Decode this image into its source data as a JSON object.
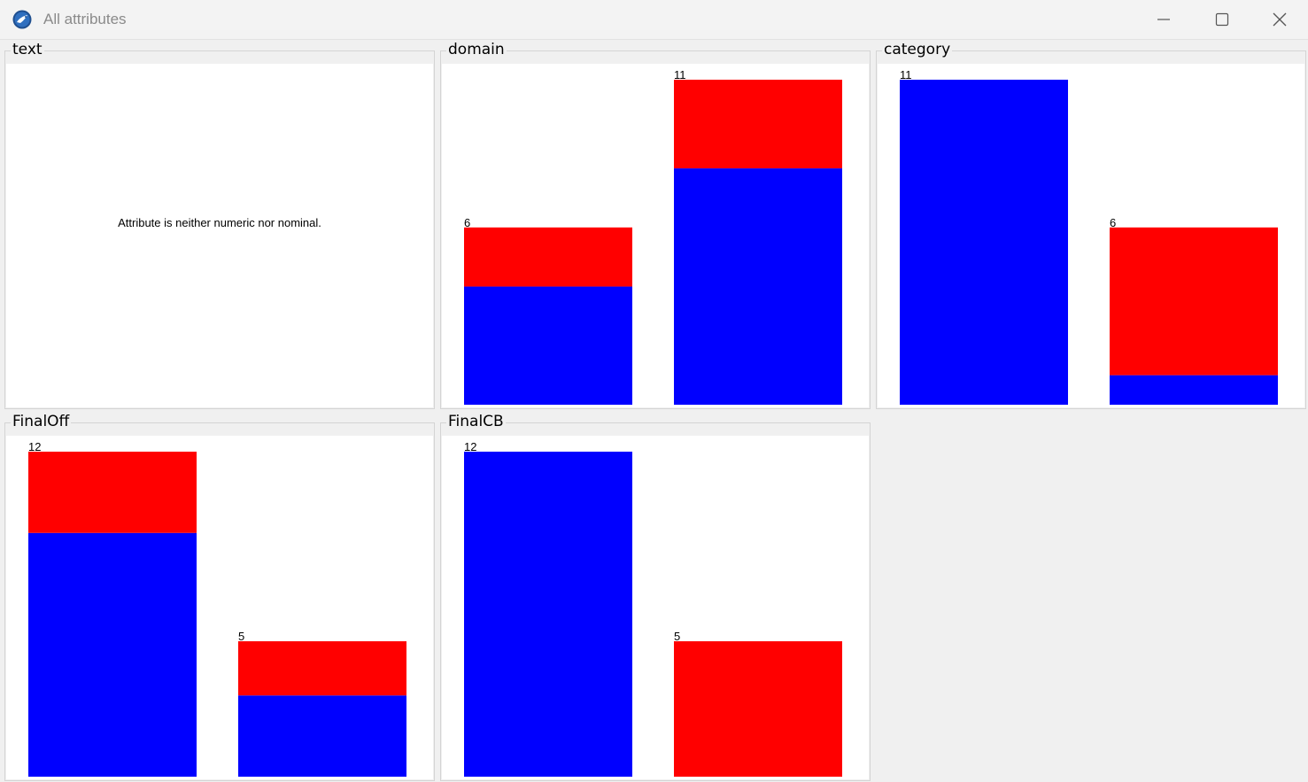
{
  "window": {
    "title": "All attributes",
    "app_icon": "weka-bird-icon",
    "controls": {
      "minimize_icon": "minimize-icon",
      "maximize_icon": "maximize-icon",
      "close_icon": "close-icon"
    }
  },
  "colors": {
    "class_a": "#0000ff",
    "class_b": "#ff0000"
  },
  "panels": [
    {
      "label": "text",
      "message": "Attribute is neither numeric nor nominal."
    },
    {
      "label": "domain"
    },
    {
      "label": "category"
    },
    {
      "label": "FinalOff"
    },
    {
      "label": "FinalCB"
    }
  ],
  "chart_data": [
    {
      "type": "bar",
      "stacked": true,
      "title": "domain",
      "bars": [
        {
          "total": 6,
          "segments": [
            4,
            2
          ],
          "label": "6"
        },
        {
          "total": 11,
          "segments": [
            8,
            3
          ],
          "label": "11"
        }
      ],
      "series_colors": [
        "#0000ff",
        "#ff0000"
      ]
    },
    {
      "type": "bar",
      "stacked": true,
      "title": "category",
      "bars": [
        {
          "total": 11,
          "segments": [
            11,
            0
          ],
          "label": "11"
        },
        {
          "total": 6,
          "segments": [
            1,
            5
          ],
          "label": "6"
        }
      ],
      "series_colors": [
        "#0000ff",
        "#ff0000"
      ]
    },
    {
      "type": "bar",
      "stacked": true,
      "title": "FinalOff",
      "bars": [
        {
          "total": 12,
          "segments": [
            9,
            3
          ],
          "label": "12"
        },
        {
          "total": 5,
          "segments": [
            3,
            2
          ],
          "label": "5"
        }
      ],
      "series_colors": [
        "#0000ff",
        "#ff0000"
      ]
    },
    {
      "type": "bar",
      "stacked": true,
      "title": "FinalCB",
      "bars": [
        {
          "total": 12,
          "segments": [
            12,
            0
          ],
          "label": "12"
        },
        {
          "total": 5,
          "segments": [
            0,
            5
          ],
          "label": "5"
        }
      ],
      "series_colors": [
        "#0000ff",
        "#ff0000"
      ]
    }
  ]
}
